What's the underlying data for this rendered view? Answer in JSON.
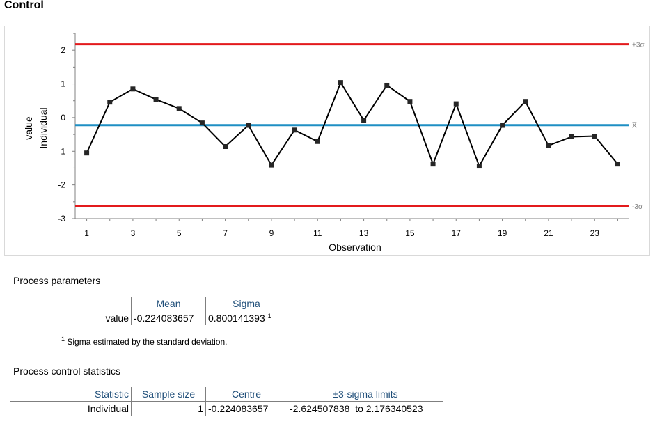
{
  "window": {
    "title": "Control"
  },
  "chart_data": {
    "type": "line",
    "xlabel": "Observation",
    "ylabel": "Individual",
    "ylabel2": "value",
    "x": [
      1,
      2,
      3,
      4,
      5,
      6,
      7,
      8,
      9,
      10,
      11,
      12,
      13,
      14,
      15,
      16,
      17,
      18,
      19,
      20,
      21,
      22,
      23,
      24
    ],
    "x_ticks": [
      1,
      3,
      5,
      7,
      9,
      11,
      13,
      15,
      17,
      19,
      21,
      23
    ],
    "y_ticks": [
      -3,
      -2,
      -1,
      0,
      1,
      2
    ],
    "xlim": [
      0.5,
      24.5
    ],
    "ylim": [
      -3,
      2.5
    ],
    "series": [
      {
        "values": [
          -1.05,
          0.46,
          0.85,
          0.54,
          0.27,
          -0.16,
          -0.86,
          -0.23,
          -1.41,
          -0.37,
          -0.71,
          1.04,
          -0.08,
          0.96,
          0.48,
          -1.38,
          0.41,
          -1.44,
          -0.23,
          0.48,
          -0.83,
          -0.57,
          -0.55,
          -1.38
        ],
        "color": "#000000"
      }
    ],
    "reference_lines": [
      {
        "label": "+3σ",
        "value": 2.176340523,
        "color": "#e31a1c"
      },
      {
        "label": "X̅",
        "value": -0.224083657,
        "color": "#1f8fc4"
      },
      {
        "label": "-3σ",
        "value": -2.624507838,
        "color": "#e31a1c"
      }
    ],
    "grid": false
  },
  "params": {
    "heading": "Process parameters",
    "col_mean": "Mean",
    "col_sigma": "Sigma",
    "row_label": "value",
    "mean": "-0.224083657",
    "sigma": "0.800141393",
    "sigma_sup": "1",
    "footnote_sup": "1",
    "footnote": "Sigma estimated by the standard deviation."
  },
  "stats": {
    "heading": "Process control statistics",
    "col_statistic": "Statistic",
    "col_sample_size": "Sample size",
    "col_centre": "Centre",
    "col_limits": "±3-sigma limits",
    "statistic": "Individual",
    "sample_size": "1",
    "centre": "-0.224083657",
    "limits": "-2.624507838  to 2.176340523"
  }
}
